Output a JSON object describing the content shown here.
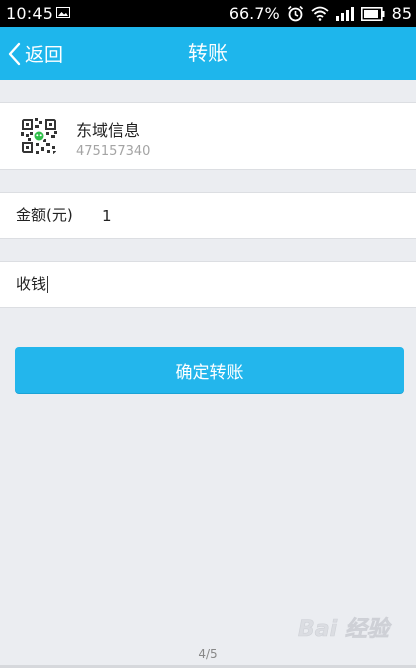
{
  "status_bar": {
    "time": "10:45",
    "battery_percent": "66.7%",
    "signal_extra": "85",
    "icons": [
      "image-icon",
      "alarm-icon",
      "wifi-icon",
      "signal-icon",
      "battery-icon"
    ]
  },
  "header": {
    "back_label": "返回",
    "title": "转账"
  },
  "recipient": {
    "name": "东域信息",
    "account": "475157340"
  },
  "amount": {
    "label": "金额(元)",
    "value": "1"
  },
  "note": {
    "value": "收钱"
  },
  "confirm_button": {
    "label": "确定转账"
  },
  "footer": {
    "page_indicator": "4/5",
    "watermark_text": "Bai 经验"
  },
  "colors": {
    "accent": "#1eb6ec",
    "background": "#ebedf1"
  }
}
